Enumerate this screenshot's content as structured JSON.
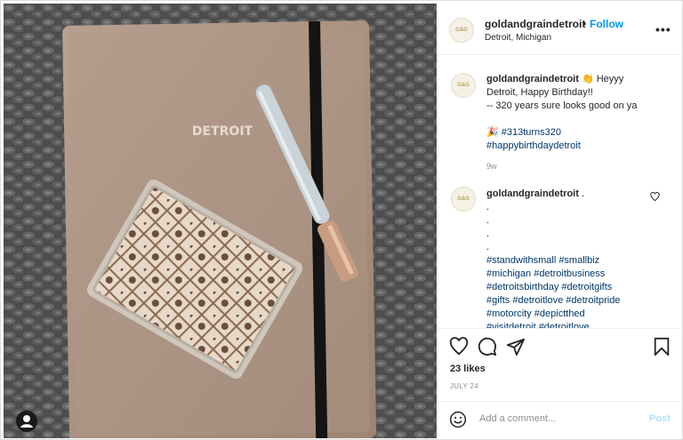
{
  "header": {
    "username": "goldandgraindetroit",
    "dot": "•",
    "follow": "Follow",
    "location": "Detroit, Michigan",
    "more": "•••",
    "avatar_text": "G&G"
  },
  "caption": {
    "username": "goldandgraindetroit",
    "line1": "👏 Heyyy",
    "line2": "Detroit, Happy Birthday!!",
    "line3": "-- 320 years sure looks good on ya",
    "tag1": "🎉 #313turns320",
    "tag2": "#happybirthdaydetroit",
    "time": "9w"
  },
  "comment": {
    "username": "goldandgraindetroit",
    "dots": [
      ".",
      ".",
      ".",
      ".",
      "."
    ],
    "tags": [
      "#standwithsmall #smallbiz",
      "#michigan #detroitbusiness",
      "#detroitsbirthday #detroitgifts",
      "#gifts #detroitlove #detroitpride",
      "#motorcity #depictthed",
      "#visitdetroit #detroitlove"
    ]
  },
  "actions": {
    "likes": "23 likes",
    "date": "JULY 24"
  },
  "add_comment": {
    "placeholder": "Add a comment...",
    "post": "Post"
  },
  "photo": {
    "notebook_label": "DETROIT"
  }
}
